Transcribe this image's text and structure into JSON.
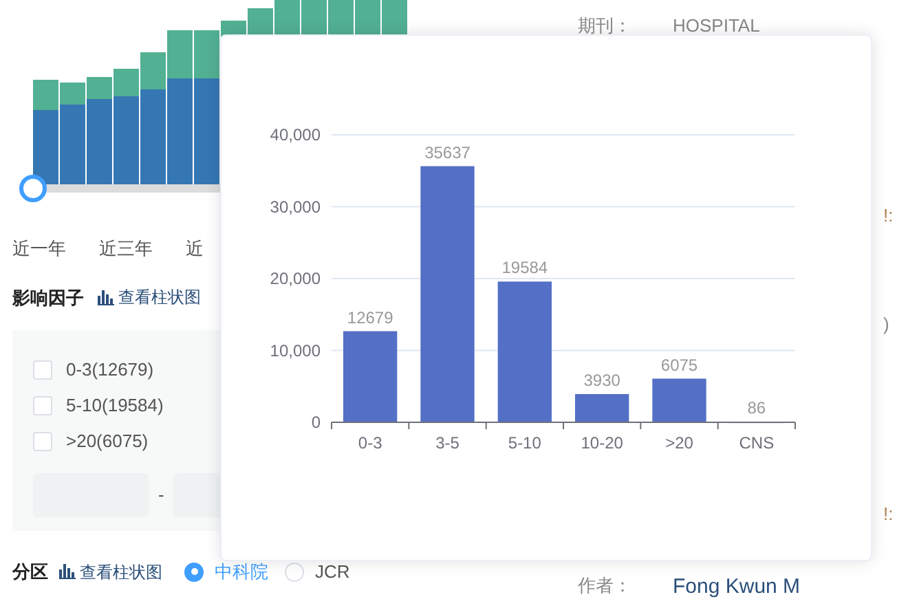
{
  "range_slider": {
    "level": 0
  },
  "period_options": [
    {
      "label": "近一年"
    },
    {
      "label": "近三年"
    },
    {
      "label": "近"
    }
  ],
  "impact_factor": {
    "title": "影响因子",
    "chart_link": "查看柱状图",
    "checkboxes": [
      {
        "label": "0-3(12679)",
        "checked": false
      },
      {
        "label": "5-10(19584)",
        "checked": false
      },
      {
        "label": ">20(6075)",
        "checked": false
      }
    ],
    "range_separator": "-"
  },
  "partition": {
    "title": "分区",
    "chart_link": "查看柱状图",
    "options": [
      {
        "label": "中科院",
        "selected": true
      },
      {
        "label": "JCR",
        "selected": false
      }
    ]
  },
  "details": [
    {
      "label": "期刊：",
      "value": "HOSPITAL"
    },
    {
      "label": "作者：",
      "value": "Fong Kwun M"
    }
  ],
  "edge_fragments": [
    "!:",
    ")",
    "!:"
  ],
  "popup": {
    "chart_data": {
      "type": "bar",
      "categories": [
        "0-3",
        "3-5",
        "5-10",
        "10-20",
        ">20",
        "CNS"
      ],
      "series": [
        {
          "color": "#5470c6",
          "values": [
            12679,
            35637,
            19584,
            3930,
            6075,
            86
          ]
        }
      ],
      "ylim": [
        0,
        40000
      ],
      "yticks": [
        {
          "value": 0,
          "label": "0"
        },
        {
          "value": 10000,
          "label": "10,000"
        },
        {
          "value": 20000,
          "label": "20,000"
        },
        {
          "value": 30000,
          "label": "30,000"
        },
        {
          "value": 40000,
          "label": "40,000"
        }
      ],
      "grid": true,
      "data_labels": true
    }
  }
}
